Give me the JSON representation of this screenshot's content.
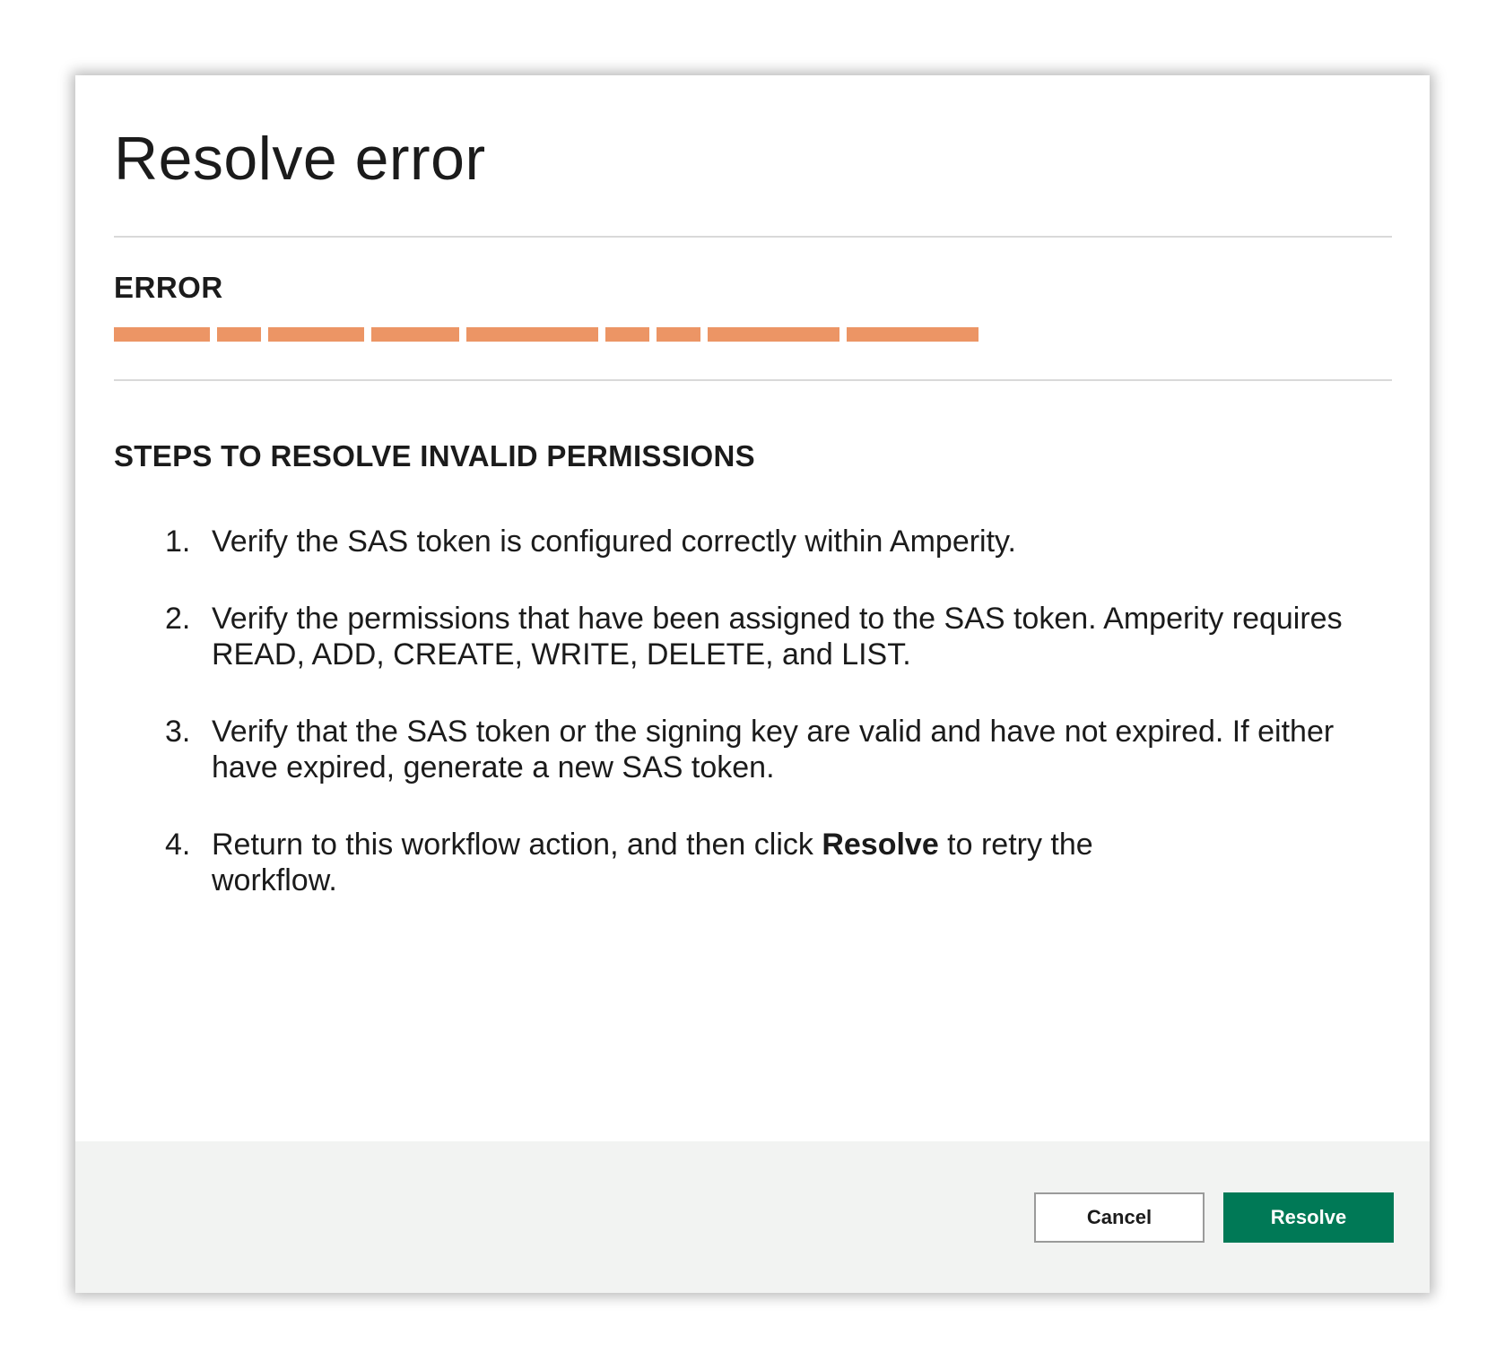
{
  "dialog": {
    "title": "Resolve error"
  },
  "error": {
    "heading": "ERROR",
    "redaction_color": "#ec9565",
    "redacted_segments": [
      107,
      49,
      107,
      98,
      147,
      49,
      49,
      147,
      147
    ]
  },
  "steps": {
    "heading": "STEPS TO RESOLVE INVALID PERMISSIONS",
    "items": [
      {
        "num": "1.",
        "text": "Verify the SAS token is configured correctly within Amperity."
      },
      {
        "num": "2.",
        "text": "Verify the permissions that have been assigned to the SAS token. Amperity requires READ, ADD, CREATE, WRITE, DELETE, and LIST."
      },
      {
        "num": "3.",
        "text": "Verify that the SAS token or the signing key are valid and have not expired. If either have expired, generate a new SAS token."
      },
      {
        "num": "4.",
        "text_before": "Return to this workflow action, and then click ",
        "bold": "Resolve",
        "text_after": " to retry the workflow."
      }
    ]
  },
  "footer": {
    "cancel_label": "Cancel",
    "resolve_label": "Resolve",
    "accent_color": "#007956"
  }
}
